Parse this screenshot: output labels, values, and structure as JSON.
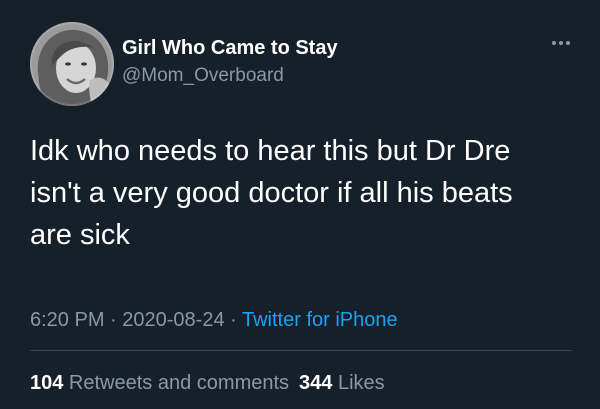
{
  "author": {
    "display_name": "Girl Who Came to Stay",
    "handle": "@Mom_Overboard"
  },
  "tweet": {
    "text_lines": [
      "Idk who needs to hear this but Dr Dre",
      "isn't a very good doctor if all his beats",
      "are sick"
    ]
  },
  "meta": {
    "time": "6:20 PM",
    "separator": " · ",
    "date": "2020-08-24",
    "source": "Twitter for iPhone"
  },
  "stats": {
    "retweets_count": "104",
    "retweets_label": " Retweets and comments",
    "likes_count": "344",
    "likes_label": " Likes"
  },
  "icons": {
    "more": "more-options-icon"
  },
  "colors": {
    "background": "#15202b",
    "secondary_text": "#8899a6",
    "link": "#1da1f2",
    "divider": "#38444d"
  }
}
